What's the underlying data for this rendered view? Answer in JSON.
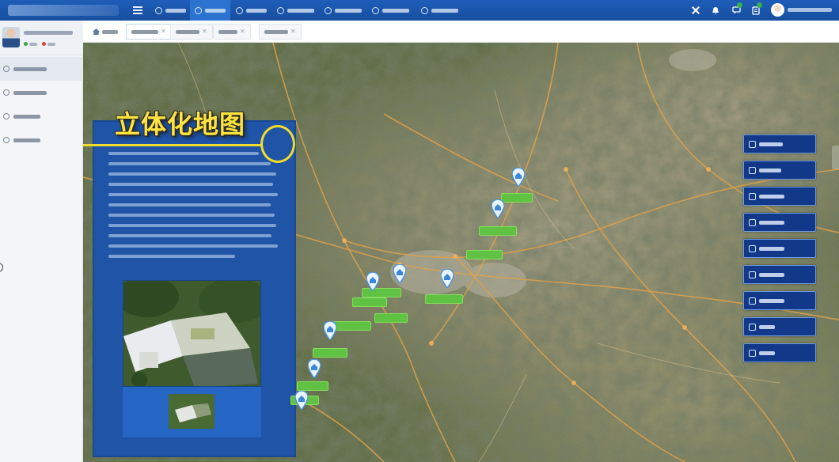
{
  "map_overlay": {
    "heading": "立体化地图"
  },
  "colors": {
    "topbar": "#1e5db8",
    "active_nav": "#2c73cf",
    "sidebar_bg": "#f3f5f8",
    "panel_bg": "#1f54a6",
    "heading_yellow": "#ffe43d",
    "callout_yellow": "#f2dc2a",
    "marker_label_green": "#5fc243",
    "right_button_bg": "#12388a"
  },
  "icons": {
    "menu_toggle": "hamburger-icon",
    "nav": [
      "home-icon",
      "grid-icon",
      "cube-icon",
      "gear-icon",
      "search-icon",
      "pin-icon",
      "drop-icon",
      "settings-icon"
    ],
    "toolbar": [
      "close-icon",
      "bell-icon",
      "message-icon",
      "task-icon"
    ],
    "tab_home": "home-icon",
    "marker": "building-pin-icon"
  }
}
